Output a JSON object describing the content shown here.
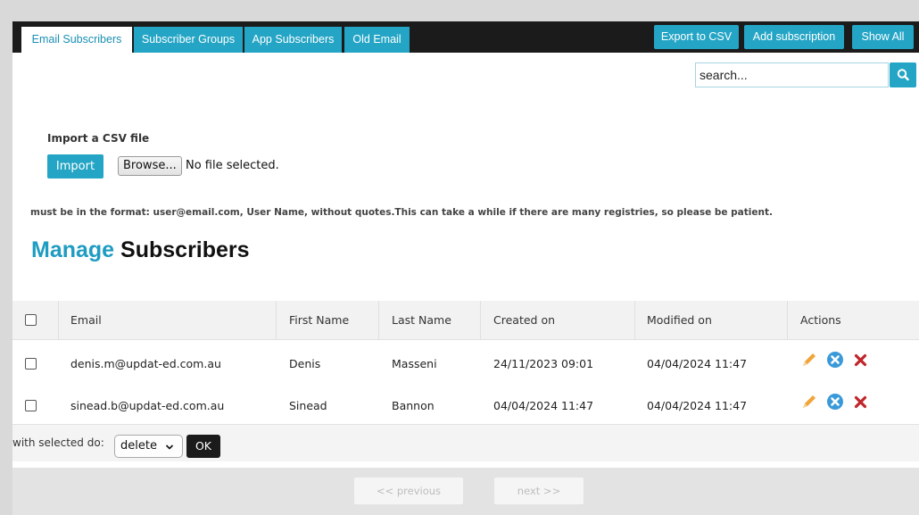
{
  "tabs": [
    {
      "label": "Email Subscribers",
      "active": true
    },
    {
      "label": "Subscriber Groups",
      "active": false
    },
    {
      "label": "App Subscribers",
      "active": false
    },
    {
      "label": "Old Email",
      "active": false
    }
  ],
  "toolbar": {
    "export_label": "Export to CSV",
    "add_label": "Add subscription",
    "show_all_label": "Show All"
  },
  "search": {
    "placeholder": "search...",
    "value": ""
  },
  "import": {
    "heading": "Import a CSV file",
    "import_label": "Import",
    "browse_label": "Browse...",
    "file_status": "No file selected.",
    "format_note": "must be in the format: user@email.com, User Name, without quotes.This can take a while if there are many registries, so please be patient."
  },
  "page_title": {
    "accent": "Manage",
    "rest": "Subscribers"
  },
  "table": {
    "columns": [
      "Email",
      "First Name",
      "Last Name",
      "Created on",
      "Modified on",
      "Actions"
    ],
    "rows": [
      {
        "email": "denis.m@updat-ed.com.au",
        "first_name": "Denis",
        "last_name": "Masseni",
        "created": "24/11/2023 09:01",
        "modified": "04/04/2024 11:47"
      },
      {
        "email": "sinead.b@updat-ed.com.au",
        "first_name": "Sinead",
        "last_name": "Bannon",
        "created": "04/04/2024 11:47",
        "modified": "04/04/2024 11:47"
      }
    ]
  },
  "bulk": {
    "label": "with selected do:",
    "selected_option": "delete",
    "ok_label": "OK"
  },
  "pagination": {
    "previous_label": "<< previous",
    "next_label": "next >>"
  },
  "icons": {
    "edit": "pencil-icon",
    "cancel": "cancel-circle-icon",
    "delete": "delete-x-icon",
    "search": "search-icon",
    "dropdown": "chevron-down-icon"
  },
  "colors": {
    "accent": "#24a5c5",
    "topbar": "#1b1b1b",
    "delete": "#c0262b",
    "edit": "#f0a43a"
  }
}
